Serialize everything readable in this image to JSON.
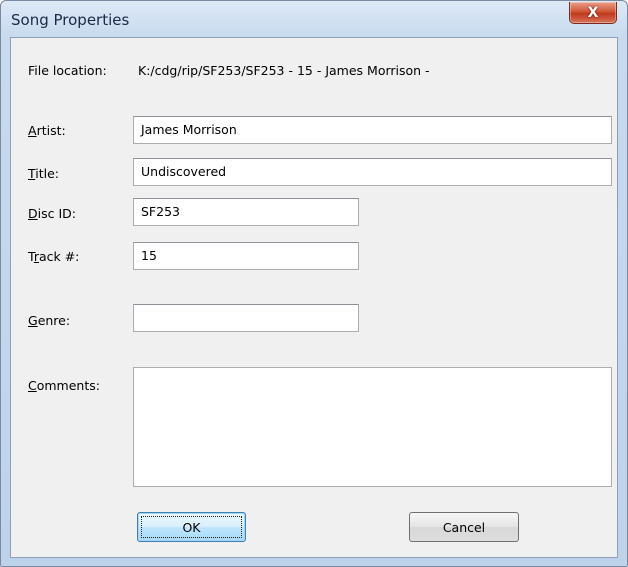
{
  "window": {
    "title": "Song Properties",
    "close_label": "X"
  },
  "file_location": {
    "label": "File location:",
    "value": "K:/cdg/rip/SF253/SF253 - 15 - James Morrison -"
  },
  "fields": {
    "artist": {
      "mnemonic": "A",
      "rest": "rtist:",
      "value": "James Morrison"
    },
    "title": {
      "mnemonic": "T",
      "rest": "itle:",
      "value": "Undiscovered"
    },
    "disc_id": {
      "mnemonic": "D",
      "rest": "isc ID:",
      "value": "SF253"
    },
    "track": {
      "before": "T",
      "mnemonic": "r",
      "rest": "ack #:",
      "value": "15"
    },
    "genre": {
      "mnemonic": "G",
      "rest": "enre:",
      "value": ""
    },
    "comments": {
      "mnemonic": "C",
      "rest": "omments:",
      "value": ""
    }
  },
  "buttons": {
    "ok_label": "OK",
    "cancel_label": "Cancel"
  }
}
